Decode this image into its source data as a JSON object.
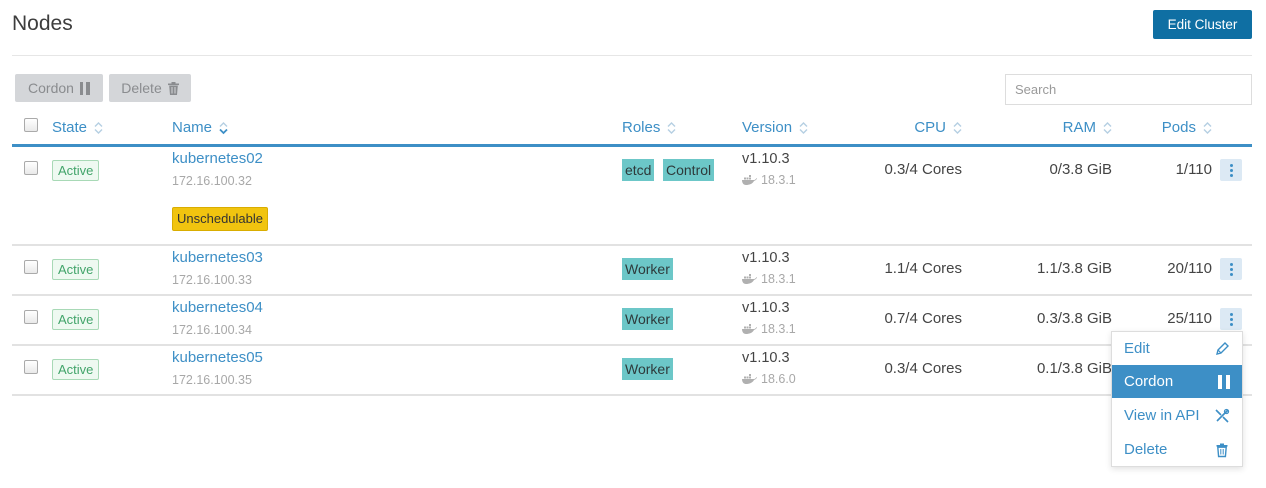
{
  "header": {
    "title": "Nodes",
    "edit_cluster_label": "Edit Cluster"
  },
  "toolbar": {
    "cordon_label": "Cordon",
    "delete_label": "Delete",
    "search_placeholder": "Search"
  },
  "columns": {
    "state": "State",
    "name": "Name",
    "roles": "Roles",
    "version": "Version",
    "cpu": "CPU",
    "ram": "RAM",
    "pods": "Pods"
  },
  "nodes": [
    {
      "state": "Active",
      "name": "kubernetes02",
      "ip": "172.16.100.32",
      "tag": "Unschedulable",
      "roles": [
        "etcd",
        "Control"
      ],
      "version": "v1.10.3",
      "docker": "18.3.1",
      "cpu": "0.3/4 Cores",
      "ram": "0/3.8 GiB",
      "pods": "1/110"
    },
    {
      "state": "Active",
      "name": "kubernetes03",
      "ip": "172.16.100.33",
      "roles": [
        "Worker"
      ],
      "version": "v1.10.3",
      "docker": "18.3.1",
      "cpu": "1.1/4 Cores",
      "ram": "1.1/3.8 GiB",
      "pods": "20/110"
    },
    {
      "state": "Active",
      "name": "kubernetes04",
      "ip": "172.16.100.34",
      "roles": [
        "Worker"
      ],
      "version": "v1.10.3",
      "docker": "18.3.1",
      "cpu": "0.7/4 Cores",
      "ram": "0.3/3.8 GiB",
      "pods": "25/110"
    },
    {
      "state": "Active",
      "name": "kubernetes05",
      "ip": "172.16.100.35",
      "roles": [
        "Worker"
      ],
      "version": "v1.10.3",
      "docker": "18.6.0",
      "cpu": "0.3/4 Cores",
      "ram": "0.1/3.8 GiB",
      "pods": ""
    }
  ],
  "context_menu": {
    "items": [
      "Edit",
      "Cordon",
      "View in API",
      "Delete"
    ],
    "active_item": "Cordon"
  },
  "colors": {
    "primary": "#0f6fa3",
    "link": "#3d8fc6",
    "role_tag": "#6cc7c8",
    "warning": "#f1c40f",
    "active_badge": "#42a46a"
  }
}
